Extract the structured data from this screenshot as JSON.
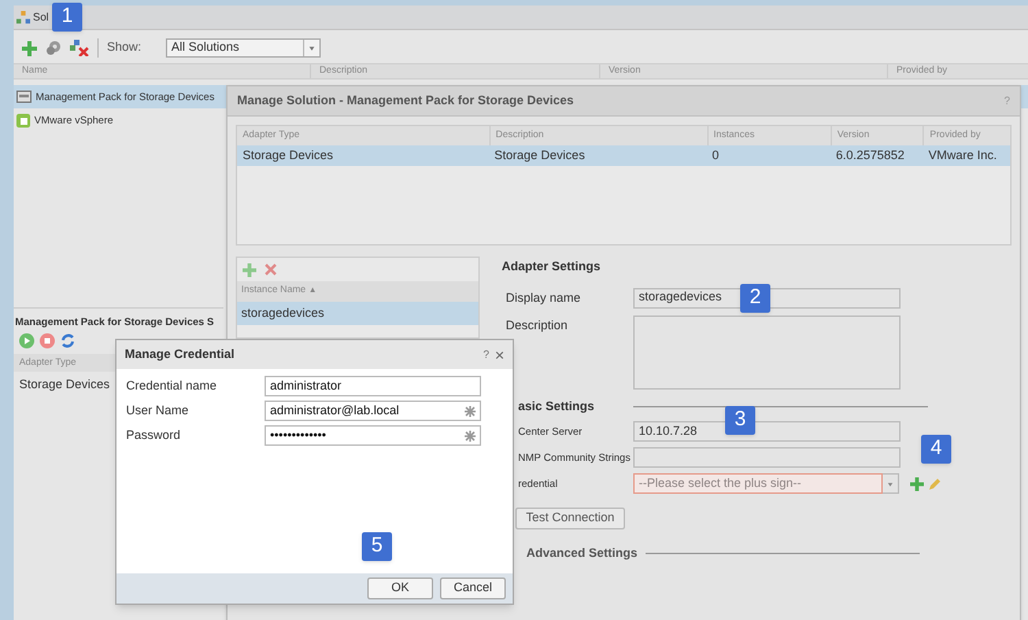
{
  "window": {
    "title": "Sol"
  },
  "toolbar": {
    "show_label": "Show:",
    "filter": {
      "value": "All Solutions"
    }
  },
  "solutions_table": {
    "columns": [
      "Name",
      "Description",
      "Version",
      "Provided by"
    ],
    "rows": [
      {
        "name": "Management Pack for Storage Devices",
        "selected": true
      },
      {
        "name": "VMware vSphere",
        "selected": false
      }
    ]
  },
  "details_panel": {
    "title": "Management Pack for Storage Devices S",
    "columns": [
      "Adapter Type"
    ],
    "rows": [
      {
        "adapter_type": "Storage Devices"
      }
    ]
  },
  "manage_solution_dialog": {
    "title": "Manage Solution - Management Pack for Storage Devices",
    "help": "?",
    "adapters_table": {
      "columns": [
        "Adapter Type",
        "Description",
        "Instances",
        "Version",
        "Provided by"
      ],
      "rows": [
        {
          "cells": [
            "Storage Devices",
            "Storage Devices",
            "0",
            "6.0.2575852",
            "VMware Inc."
          ],
          "selected": true
        }
      ]
    },
    "instances": {
      "columns": [
        "Instance Name"
      ],
      "sort_indicator": "▲",
      "rows": [
        {
          "name": "storagedevices",
          "selected": true
        }
      ]
    },
    "adapter_settings": {
      "title": "Adapter Settings",
      "fields": [
        {
          "label": "Display name",
          "value": "storagedevices",
          "kind": "text"
        },
        {
          "label": "Description",
          "kind": "textarea"
        }
      ]
    },
    "basic_settings": {
      "title": "asic Settings",
      "fields": [
        {
          "label": "Center Server",
          "value": "10.10.7.28",
          "kind": "text"
        },
        {
          "label": "NMP Community Strings",
          "kind": "text"
        },
        {
          "label": "redential",
          "placeholder": "--Please select the plus sign--",
          "kind": "select",
          "invalid": true
        }
      ]
    },
    "test_button": "Test Connection",
    "advanced_settings": {
      "title": "Advanced Settings"
    }
  },
  "credential_dialog": {
    "title": "Manage Credential",
    "help": "?",
    "close": "×",
    "fields": [
      {
        "label": "Credential name",
        "value": "administrator",
        "required": false
      },
      {
        "label": "User Name",
        "value": "administrator@lab.local",
        "required": true
      },
      {
        "label": "Password",
        "value": "•••••••••••••",
        "required": true
      }
    ],
    "buttons": [
      "OK",
      "Cancel"
    ]
  },
  "badges": [
    {
      "number": "1"
    },
    {
      "number": "2"
    },
    {
      "number": "3"
    },
    {
      "number": "4"
    },
    {
      "number": "5"
    }
  ]
}
